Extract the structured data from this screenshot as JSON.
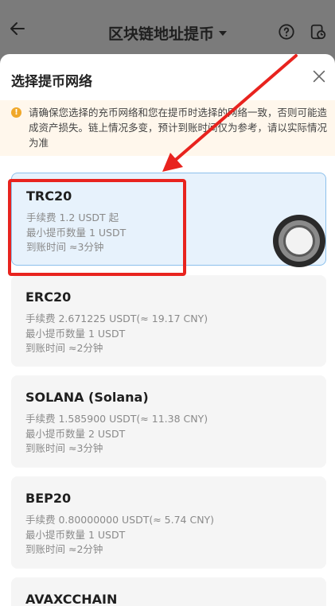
{
  "header": {
    "title": "区块链地址提币"
  },
  "sheet": {
    "title": "选择提币网络",
    "notice": "请确保您选择的充币网络和您在提币时选择的网络一致，否则可能造成资产损失。链上情况多变，预计到账时间仅为参考，请以实际情况为准"
  },
  "networks": [
    {
      "name": "TRC20",
      "fee": "手续费 1.2 USDT 起",
      "min": "最小提币数量 1 USDT",
      "time": "到账时间 ≈3分钟"
    },
    {
      "name": "ERC20",
      "fee": "手续费 2.671225 USDT(≈ 19.17 CNY)",
      "min": "最小提币数量 1 USDT",
      "time": "到账时间 ≈2分钟"
    },
    {
      "name": "SOLANA (Solana)",
      "fee": "手续费 1.585900 USDT(≈ 11.38 CNY)",
      "min": "最小提币数量 2 USDT",
      "time": "到账时间 ≈3分钟"
    },
    {
      "name": "BEP20",
      "fee": "手续费 0.80000000 USDT(≈ 5.74 CNY)",
      "min": "最小提币数量 1 USDT",
      "time": "到账时间 ≈2分钟"
    },
    {
      "name": "AVAXCCHAIN"
    }
  ],
  "colors": {
    "accent_red": "#e8231e",
    "selected_bg": "#e7f2fc",
    "warn": "#f0a82a"
  }
}
